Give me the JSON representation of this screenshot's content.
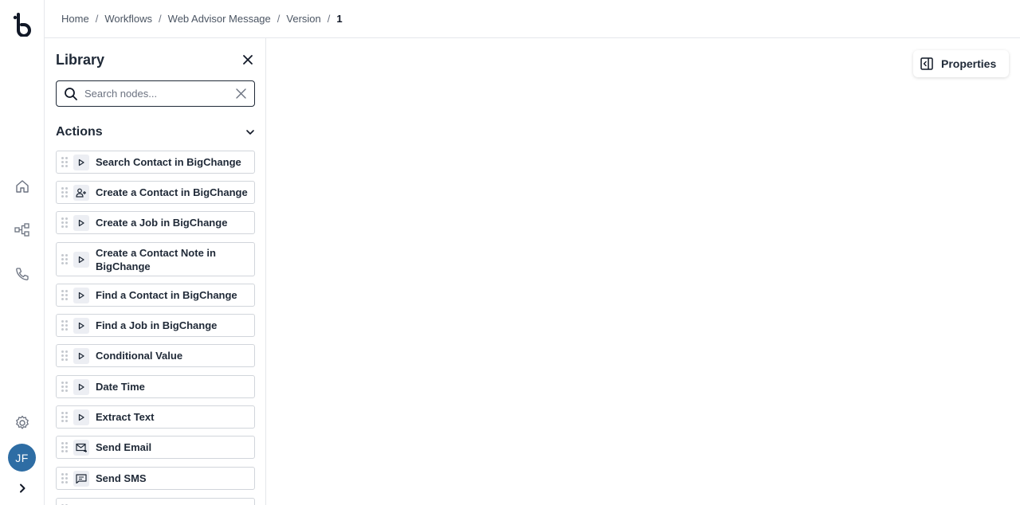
{
  "breadcrumb": [
    "Home",
    "Workflows",
    "Web Advisor Message",
    "Version",
    "1"
  ],
  "rail": {
    "avatar_initials": "JF",
    "icons": [
      "logo-icon",
      "home-icon",
      "workflow-icon",
      "phone-icon",
      "settings-icon",
      "chevron-right-icon"
    ]
  },
  "library": {
    "title": "Library",
    "search_placeholder": "Search nodes...",
    "search_value": "",
    "section_label": "Actions",
    "nodes": [
      {
        "label": "Search Contact in BigChange",
        "icon": "play-icon"
      },
      {
        "label": "Create a Contact in BigChange",
        "icon": "user-add-icon"
      },
      {
        "label": "Create a Job in BigChange",
        "icon": "play-icon"
      },
      {
        "label": "Create a Contact Note in BigChange",
        "icon": "play-icon"
      },
      {
        "label": "Find a Contact in BigChange",
        "icon": "play-icon"
      },
      {
        "label": "Find a Job in BigChange",
        "icon": "play-icon"
      },
      {
        "label": "Conditional Value",
        "icon": "play-icon"
      },
      {
        "label": "Date Time",
        "icon": "play-icon"
      },
      {
        "label": "Extract Text",
        "icon": "play-icon"
      },
      {
        "label": "Send Email",
        "icon": "email-icon"
      },
      {
        "label": "Send SMS",
        "icon": "sms-icon"
      }
    ]
  },
  "canvas": {
    "properties_label": "Properties"
  },
  "colors": {
    "avatar": "#2e6da4",
    "node_icon_bg": "#eceef3",
    "border": "#d1d5db"
  }
}
